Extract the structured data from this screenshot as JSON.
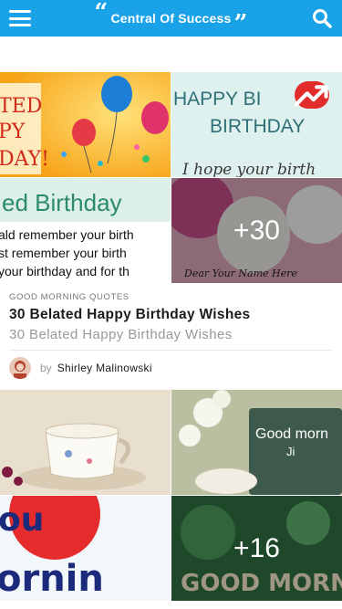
{
  "header": {
    "title": "Central Of Success",
    "open_quote": "“",
    "close_quote": "”",
    "menu_icon": "hamburger-menu-icon",
    "search_icon": "search-icon",
    "color": "#1aa2e8"
  },
  "posts": [
    {
      "category": "GOOD MORNING QUOTES",
      "title": "30 Belated Happy Birthday Wishes",
      "subtitle": "30 Belated Happy Birthday Wishes",
      "by_label": "by",
      "author": "Shirley Malinowski",
      "more_count": "+30",
      "trending_icon": "trending-up-icon",
      "images": {
        "tile1_text": [
          "TED",
          "PY",
          "DAY!"
        ],
        "tile2_text": [
          "HAPPY BI",
          "BIRTHDAY",
          "I hope your birth"
        ],
        "tile3_text": [
          "ed Birthday",
          "ald remember your birth",
          "st remember your birth",
          "your birthday and for th"
        ],
        "tile4_text": "Dear Your Name Here"
      }
    },
    {
      "more_count": "+16",
      "images": {
        "tile2_text": [
          "Good morn",
          "Ji"
        ],
        "tile3_text": [
          "ou",
          "ornin"
        ],
        "tile4_text": "GOOD MORNI"
      }
    }
  ]
}
